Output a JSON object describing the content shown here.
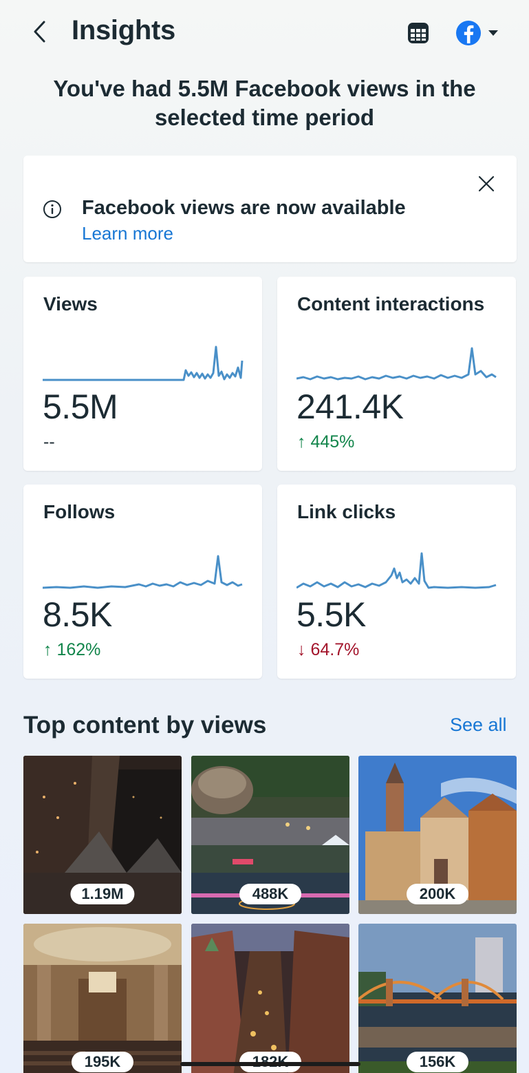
{
  "header": {
    "title": "Insights",
    "back_icon": "chevron-left-icon",
    "table_icon": "table-icon",
    "account_icon": "facebook-logo-icon"
  },
  "headline": "You've had 5.5M Facebook views in the selected time period",
  "info_banner": {
    "title": "Facebook views are now available",
    "link": "Learn more"
  },
  "metrics": [
    {
      "label": "Views",
      "value": "5.5M",
      "change": "--",
      "trend": "neutral"
    },
    {
      "label": "Content interactions",
      "value": "241.4K",
      "change": "↑ 445%",
      "trend": "up"
    },
    {
      "label": "Follows",
      "value": "8.5K",
      "change": "↑ 162%",
      "trend": "up"
    },
    {
      "label": "Link clicks",
      "value": "5.5K",
      "change": "↓ 64.7%",
      "trend": "down"
    }
  ],
  "top_content": {
    "title": "Top content by views",
    "see_all": "See all",
    "items": [
      {
        "views": "1.19M"
      },
      {
        "views": "488K"
      },
      {
        "views": "200K"
      },
      {
        "views": "195K"
      },
      {
        "views": "182K"
      },
      {
        "views": "156K"
      }
    ]
  },
  "colors": {
    "accent": "#1877d4",
    "sparkline": "#4a90c8",
    "up": "#12854b",
    "down": "#a3142b"
  }
}
